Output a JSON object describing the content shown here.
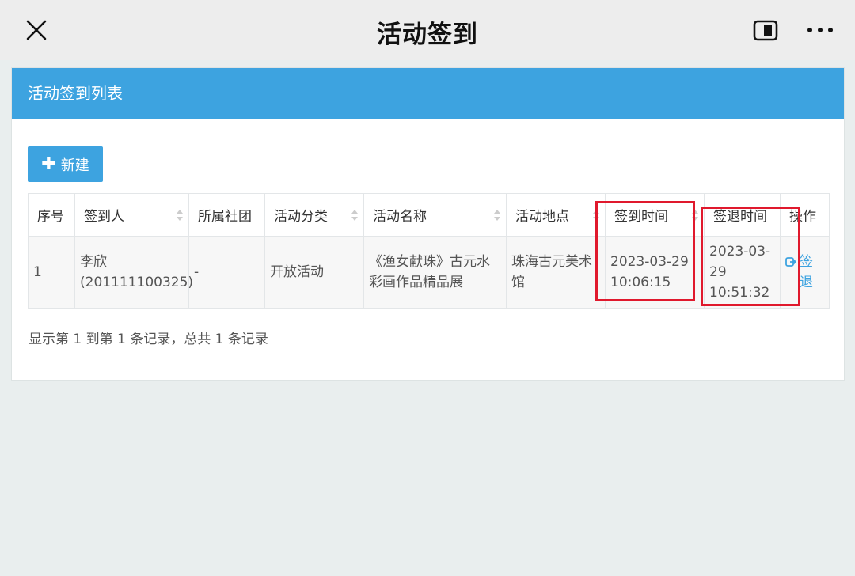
{
  "topbar": {
    "title": "活动签到",
    "icons": [
      "close-icon",
      "minimize-window-icon",
      "more-icon"
    ]
  },
  "panel": {
    "title": "活动签到列表",
    "new_button": "新建"
  },
  "table": {
    "headers": [
      "序号",
      "签到人",
      "所属社团",
      "活动分类",
      "活动名称",
      "活动地点",
      "签到时间",
      "签退时间",
      "操作"
    ],
    "sortable": [
      false,
      true,
      false,
      false,
      true,
      false,
      false,
      false,
      false
    ],
    "rows": [
      {
        "index": "1",
        "person": "李欣 (201111100325)",
        "club": "-",
        "category": "开放活动",
        "activity": "《渔女献珠》古元水彩画作品精品展",
        "location": "珠海古元美术馆",
        "checkin": "2023-03-29 10:06:15",
        "checkout": "2023-03-29 10:51:32",
        "action": "签退"
      }
    ]
  },
  "summary": "显示第 1 到第 1 条记录，总共 1 条记录",
  "colors": {
    "accent": "#3da3e0",
    "highlight": "#e0192d",
    "page_bg": "#e9eeee"
  }
}
